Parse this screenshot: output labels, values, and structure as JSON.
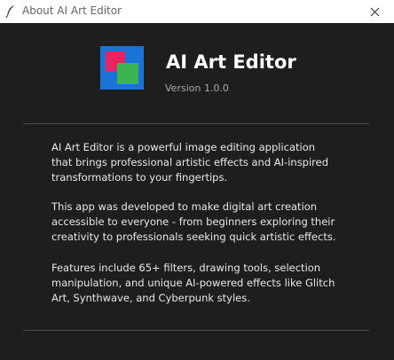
{
  "window": {
    "title": "About AI Art Editor",
    "icon": "feather-icon",
    "close_icon": "close-icon"
  },
  "header": {
    "app_name": "AI Art Editor",
    "version": "Version 1.0.0",
    "logo_colors": {
      "background": "#1a73d8",
      "pink": "#e8255e",
      "green": "#3cb550"
    }
  },
  "description": {
    "paragraph1": [
      "AI Art Editor is a powerful image editing application",
      "that brings professional artistic effects and AI-inspired",
      "transformations to your fingertips."
    ],
    "paragraph2": [
      "This app was developed to make digital art creation",
      "accessible to everyone - from beginners exploring their",
      "creativity to professionals seeking quick artistic effects."
    ],
    "paragraph3": [
      "Features include 65+ filters, drawing tools, selection",
      "manipulation, and unique AI-powered effects like Glitch",
      "Art, Synthwave, and Cyberpunk styles."
    ]
  }
}
